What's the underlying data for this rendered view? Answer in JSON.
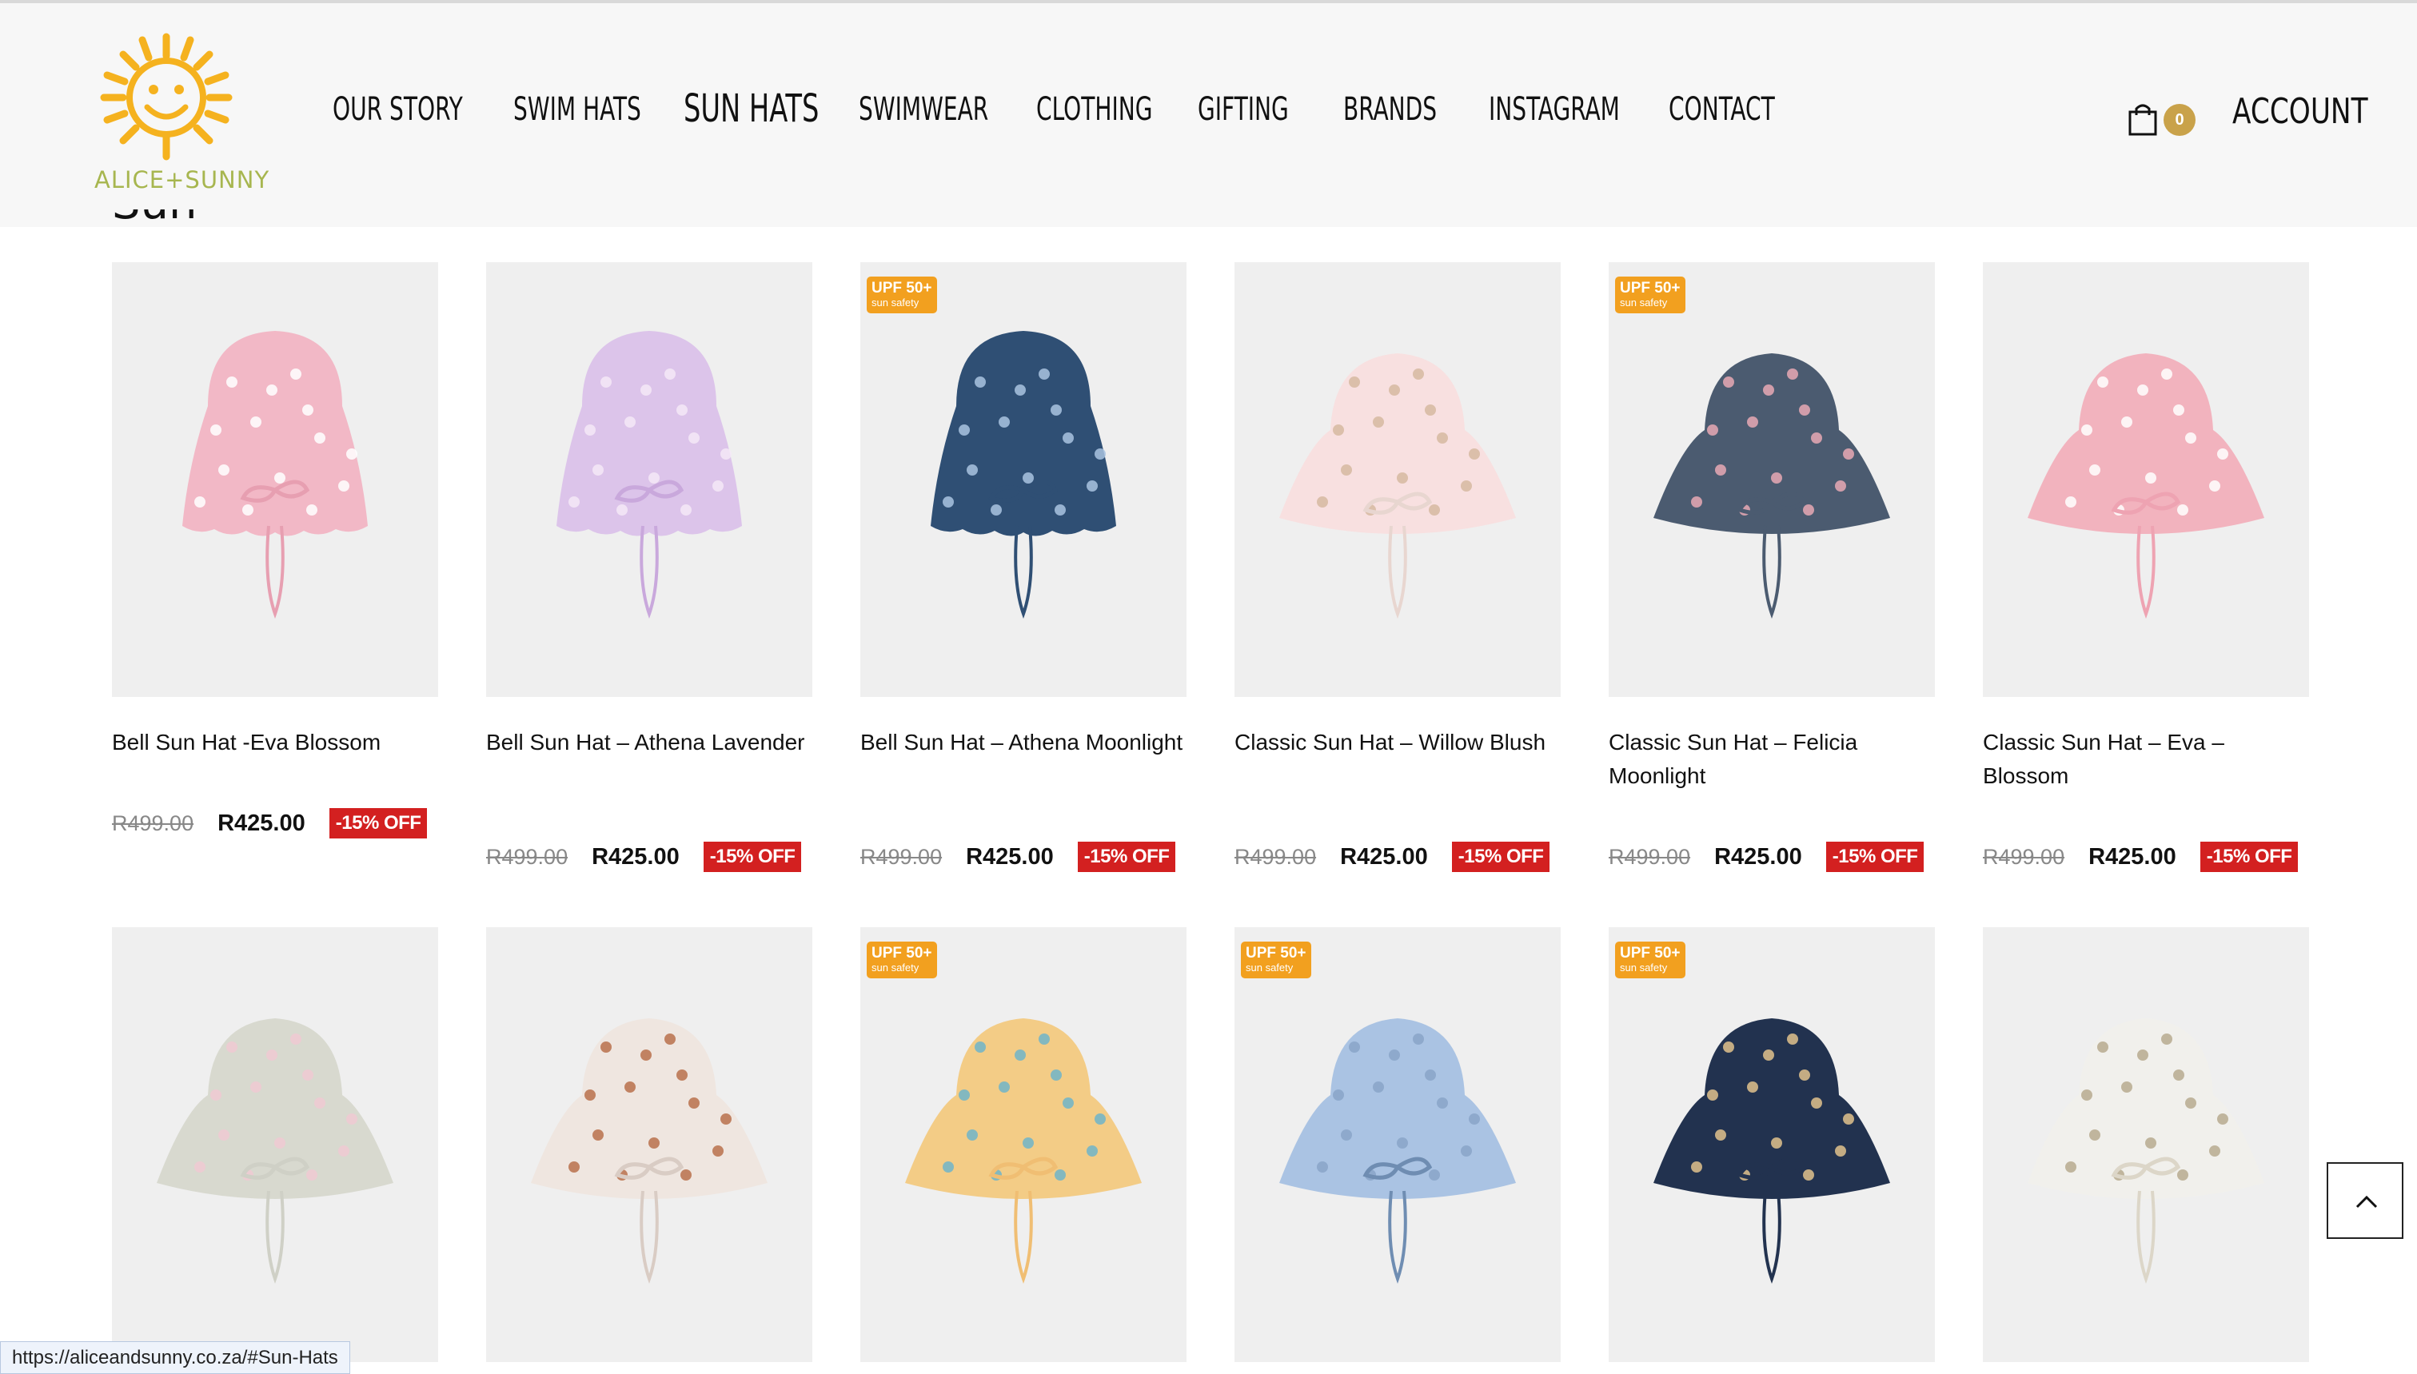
{
  "brand": {
    "logo_text": "ALICE+SUNNY",
    "accent": "#f5b21f",
    "logo_text_color": "#a7b64f"
  },
  "nav": {
    "items": [
      {
        "label": "Our Story",
        "icon": ""
      },
      {
        "label": "Swim Hats"
      },
      {
        "label": "Sun Hats",
        "active": true
      },
      {
        "label": "Swimwear"
      },
      {
        "label": "Clothing"
      },
      {
        "label": "Gifting"
      },
      {
        "label": "Brands"
      },
      {
        "label": "Instagram"
      },
      {
        "label": "Contact"
      }
    ]
  },
  "header": {
    "cart_icon": "shopping-bag-icon",
    "cart_count": "0",
    "account_label": "Account"
  },
  "section": {
    "heading": "Sun Hats"
  },
  "badges": {
    "upf_line1": "UPF 50+",
    "upf_line2": "sun safety",
    "sale_label": "-15% OFF",
    "upf_color": "#f2a01f",
    "sale_color": "#d32020"
  },
  "products": [
    {
      "name": "Bell Sun Hat -Eva Blossom",
      "old_price": "R499.00",
      "price": "R425.00",
      "discount": "-15% OFF",
      "upf": false
    },
    {
      "name": "Bell Sun Hat – Athena Lavender",
      "old_price": "R499.00",
      "price": "R425.00",
      "discount": "-15% OFF",
      "upf": false
    },
    {
      "name": "Bell Sun Hat – Athena Moonlight",
      "old_price": "R499.00",
      "price": "R425.00",
      "discount": "-15% OFF",
      "upf": true
    },
    {
      "name": "Classic Sun Hat – Willow Blush",
      "old_price": "R499.00",
      "price": "R425.00",
      "discount": "-15% OFF",
      "upf": false
    },
    {
      "name": "Classic Sun Hat – Felicia Moonlight",
      "old_price": "R499.00",
      "price": "R425.00",
      "discount": "-15% OFF",
      "upf": true
    },
    {
      "name": "Classic Sun Hat – Eva – Blossom",
      "old_price": "R499.00",
      "price": "R425.00",
      "discount": "-15% OFF",
      "upf": false
    }
  ],
  "products_row2": [
    {
      "upf": false
    },
    {
      "upf": false
    },
    {
      "upf": true
    },
    {
      "upf": true
    },
    {
      "upf": true
    },
    {
      "upf": false
    }
  ],
  "back_to_top": {
    "icon": "chevron-up-icon"
  },
  "status_bar": {
    "url": "https://aliceandsunny.co.za/#Sun-Hats"
  }
}
